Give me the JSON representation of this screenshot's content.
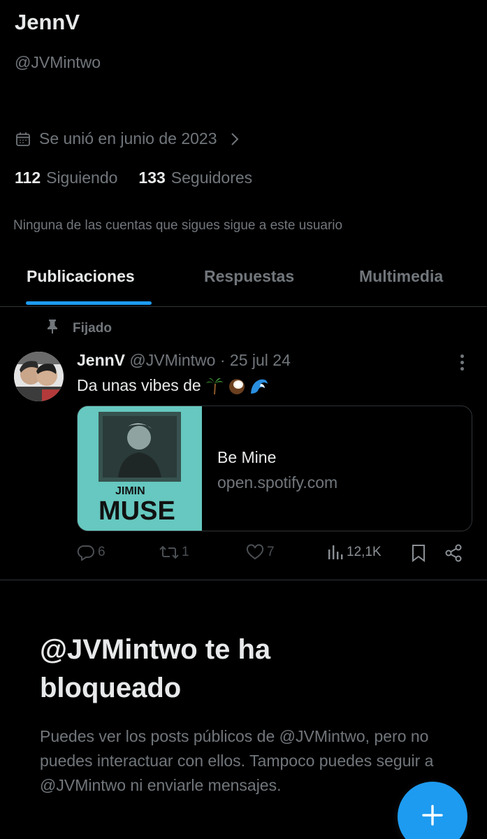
{
  "profile": {
    "display_name": "JennV",
    "handle": "@JVMintwo",
    "joined": "Se unió en junio de 2023",
    "following_count": "112",
    "following_label": "Siguiendo",
    "followers_count": "133",
    "followers_label": "Seguidores",
    "mutual_note": "Ninguna de las cuentas que sigues sigue a este usuario"
  },
  "tabs": [
    {
      "label": "Publicaciones",
      "active": true
    },
    {
      "label": "Respuestas",
      "active": false
    },
    {
      "label": "Multimedia",
      "active": false
    }
  ],
  "post": {
    "pinned_label": "Fijado",
    "author": "JennV",
    "meta": "@JVMintwo · 25 jul 24",
    "text": "Da unas vibes de",
    "emojis": [
      "palm-tree",
      "coconut",
      "wave"
    ],
    "card": {
      "title": "Be Mine",
      "domain": "open.spotify.com",
      "art_artist": "JIMIN",
      "art_title": "MUSE"
    },
    "stats": {
      "replies": "6",
      "reposts": "1",
      "likes": "7",
      "views": "12,1K"
    }
  },
  "blocked": {
    "title": "@JVMintwo te ha bloqueado",
    "description": "Puedes ver los posts públicos de @JVMintwo, pero no puedes interactuar con ellos. Tampoco puedes seguir a @JVMintwo ni enviarle mensajes."
  },
  "icons": {
    "calendar": "calendar-icon",
    "chevron": "chevron-right-icon",
    "pin": "pin-icon",
    "more": "more-vertical-icon",
    "reply": "reply-icon",
    "repost": "repost-icon",
    "like": "heart-icon",
    "views": "views-icon",
    "bookmark": "bookmark-icon",
    "share": "share-icon",
    "compose": "plus-icon"
  },
  "colors": {
    "accent": "#1d9bf0",
    "background": "#000000",
    "text_primary": "#e7e9ea",
    "text_secondary": "#71767b"
  }
}
